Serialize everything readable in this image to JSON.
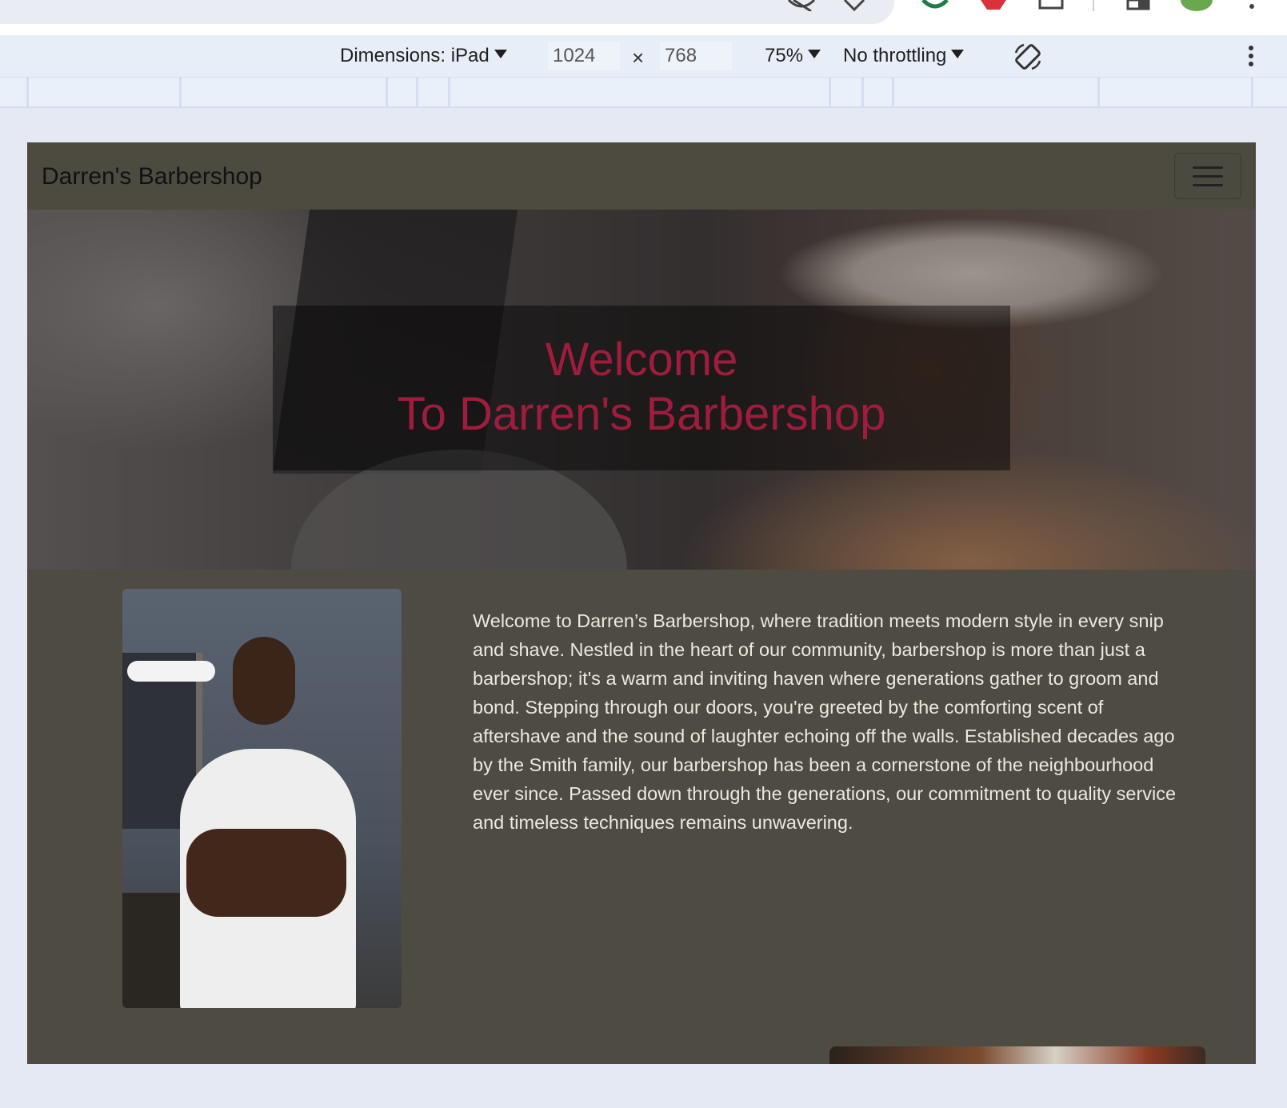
{
  "devtools": {
    "dimensions_label": "Dimensions: iPad",
    "width_value": "1024",
    "times_symbol": "×",
    "height_value": "768",
    "zoom_label": "75%",
    "throttling_label": "No throttling"
  },
  "site": {
    "brand": "Darren's Barbershop",
    "hero": {
      "line1": "Welcome",
      "line2": "To Darren's Barbershop"
    },
    "about": {
      "text": "Welcome to Darren’s Barbershop, where tradition meets modern style in every snip and shave. Nestled in the heart of our community, barbershop is more than just a barbershop; it's a warm and inviting haven where generations gather to groom and bond. Stepping through our doors, you're greeted by the comforting scent of aftershave and the sound of laughter echoing off the walls. Established decades ago by the Smith family, our barbershop has been a cornerstone of the neighbourhood ever since. Passed down through the generations, our commitment to quality service and timeless techniques remains unwavering."
    }
  },
  "colors": {
    "page_bg": "#4e4c42",
    "hero_title": "#9e1d3c",
    "about_text": "#ece8e0"
  }
}
